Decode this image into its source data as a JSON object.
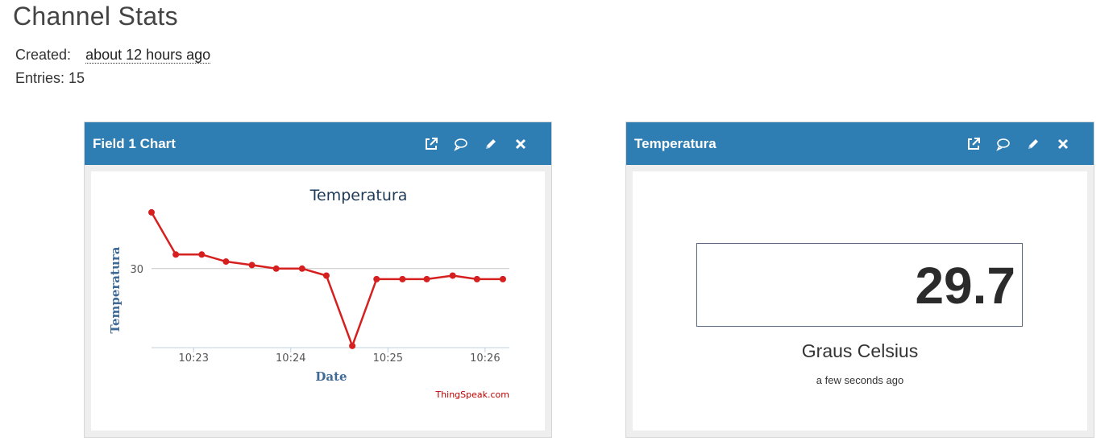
{
  "page": {
    "title": "Channel Stats",
    "created_label": "Created:",
    "created_value": "about 12 hours ago",
    "entries_label": "Entries: 15"
  },
  "widgets": [
    {
      "title": "Field 1 Chart",
      "icons": [
        "external-link-icon",
        "comment-icon",
        "pencil-icon",
        "close-icon"
      ]
    },
    {
      "title": "Temperatura",
      "icons": [
        "external-link-icon",
        "comment-icon",
        "pencil-icon",
        "close-icon"
      ]
    }
  ],
  "lamp": {
    "value": "29.7",
    "units": "Graus Celsius",
    "time": "a few seconds ago"
  },
  "colors": {
    "header": "#2e7eb3",
    "line": "#d62020",
    "axis_title": "#3f6a96",
    "chart_title": "#1e3a57",
    "credit": "#c00000"
  },
  "chart_data": {
    "type": "line",
    "title": "Temperatura",
    "xlabel": "Date",
    "ylabel": "Temperatura",
    "credit": "ThingSpeak.com",
    "x_ticks": [
      "10:23",
      "10:24",
      "10:25",
      "10:26"
    ],
    "y_ticks": [
      30
    ],
    "y_tick_labels": [
      "30"
    ],
    "series": [
      {
        "x": [
          "10:22:34",
          "10:22:49",
          "10:23:05",
          "10:23:20",
          "10:23:36",
          "10:23:51",
          "10:24:07",
          "10:24:22",
          "10:24:38",
          "10:24:53",
          "10:25:09",
          "10:25:24",
          "10:25:40",
          "10:25:55",
          "10:26:11"
        ],
        "values": [
          31.6,
          30.4,
          30.4,
          30.2,
          30.1,
          30.0,
          30.0,
          29.8,
          27.8,
          29.7,
          29.7,
          29.7,
          29.8,
          29.7,
          29.7
        ]
      }
    ],
    "xlim": [
      "10:22:34",
      "10:26:15"
    ],
    "ylim": [
      27.75,
      31.85
    ],
    "legend": "none",
    "grid": "horizontal at ticks"
  }
}
